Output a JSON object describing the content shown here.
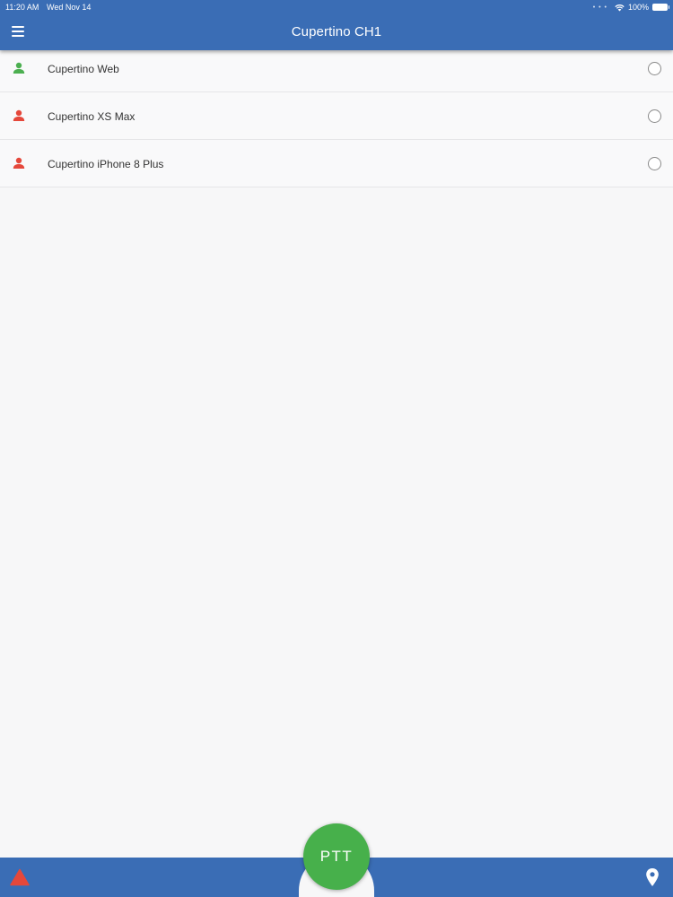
{
  "status": {
    "time": "11:20 AM",
    "date": "Wed Nov 14",
    "battery": "100%",
    "wifi_icon": "wifi-icon",
    "battery_icon": "battery-icon"
  },
  "header": {
    "title": "Cupertino CH1",
    "menu_icon": "hamburger-menu-icon"
  },
  "contacts": [
    {
      "name": "Cupertino Web",
      "status_color": "#4caf50",
      "icon": "person-icon"
    },
    {
      "name": "Cupertino XS Max",
      "status_color": "#e5483b",
      "icon": "person-icon"
    },
    {
      "name": "Cupertino iPhone 8 Plus",
      "status_color": "#e5483b",
      "icon": "person-icon"
    }
  ],
  "footer": {
    "ptt_label": "PTT",
    "alert_icon": "warning-triangle-icon",
    "location_icon": "location-pin-icon"
  },
  "colors": {
    "app_bar": "#3a6db5",
    "ptt_button": "#47b04b",
    "alert": "#e5483b",
    "online": "#4caf50",
    "offline": "#e5483b"
  }
}
